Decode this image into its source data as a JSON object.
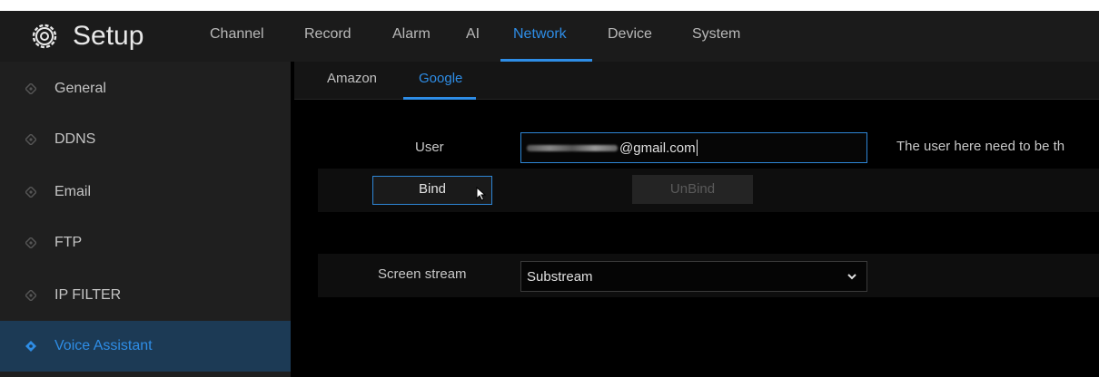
{
  "header": {
    "title": "Setup",
    "icon": "gear-icon",
    "tabs": [
      {
        "label": "Channel"
      },
      {
        "label": "Record"
      },
      {
        "label": "Alarm"
      },
      {
        "label": "AI"
      },
      {
        "label": "Network",
        "active": true
      },
      {
        "label": "Device"
      },
      {
        "label": "System"
      }
    ]
  },
  "sidebar": {
    "items": [
      {
        "label": "General"
      },
      {
        "label": "DDNS"
      },
      {
        "label": "Email"
      },
      {
        "label": "FTP"
      },
      {
        "label": "IP FILTER"
      },
      {
        "label": "Voice Assistant",
        "active": true
      }
    ]
  },
  "subtabs": [
    {
      "label": "Amazon"
    },
    {
      "label": "Google",
      "active": true
    }
  ],
  "form": {
    "user_label": "User",
    "user_value_visible": "@gmail.com",
    "help_text": "The user here need to be th",
    "bind_label": "Bind",
    "unbind_label": "UnBind",
    "screen_stream_label": "Screen stream",
    "screen_stream_value": "Substream"
  },
  "colors": {
    "accent": "#2e8de6",
    "header_bg": "#1b1b1b",
    "sidebar_bg": "#1f1f1f",
    "sidebar_active_bg": "#1c3a55"
  }
}
